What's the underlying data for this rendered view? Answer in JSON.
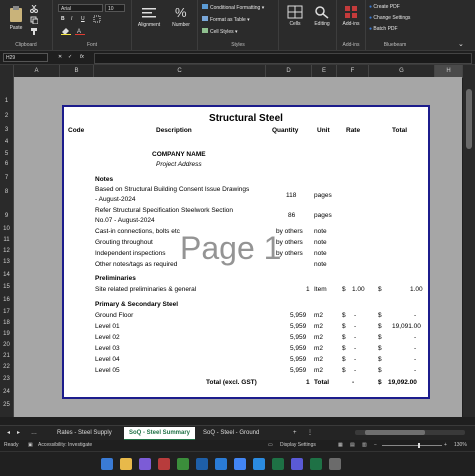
{
  "ribbon": {
    "clipboard": {
      "paste": "Paste",
      "label": "Clipboard"
    },
    "font": {
      "name": "Arial",
      "size": "10",
      "label": "Font",
      "bold": "B",
      "italic": "I",
      "underline": "U"
    },
    "alignment": "Alignment",
    "number": "Number",
    "styles": {
      "conditional": "Conditional Formatting",
      "table": "Format as Table",
      "cell_styles": "Cell Styles",
      "label": "Styles"
    },
    "cells": "Cells",
    "editing": "Editing",
    "addins": {
      "button": "Add-ins",
      "label": "Add-ins"
    },
    "bluebeam": {
      "create": "Create PDF",
      "change": "Change Settings",
      "batch": "Batch PDF",
      "label": "Bluebeam"
    }
  },
  "formula_bar": {
    "cell": "H29",
    "fx": "fx"
  },
  "columns": [
    "A",
    "B",
    "C",
    "D",
    "E",
    "F",
    "G",
    "H"
  ],
  "rows": [
    "1",
    "2",
    "3",
    "4",
    "5",
    "6",
    "7",
    "8",
    "9",
    "10",
    "11",
    "12",
    "13",
    "14",
    "15",
    "16",
    "17",
    "18",
    "19",
    "20",
    "21",
    "22",
    "23",
    "24",
    "25"
  ],
  "sheet": {
    "title": "Structural Steel",
    "headers": {
      "code": "Code",
      "description": "Description",
      "quantity": "Quantity",
      "unit": "Unit",
      "rate": "Rate",
      "total": "Total"
    },
    "company": "COMPANY NAME",
    "project": "Project Address",
    "notes_title": "Notes",
    "notes": [
      {
        "text": "Based on Structural Building Consent Issue Drawings",
        "text2": "- August-2024",
        "qty": "118",
        "unit": "pages"
      },
      {
        "text": "Refer Structural Specification Steelwork Section",
        "text2": "No.07 - August-2024",
        "qty": "86",
        "unit": "pages"
      },
      {
        "text": "Cast-in connections, bolts etc",
        "qty": "by others",
        "unit": "note"
      },
      {
        "text": "Grouting throughout",
        "qty": "by others",
        "unit": "note"
      },
      {
        "text": "Independent inspections",
        "qty": "by others",
        "unit": "note"
      },
      {
        "text": "Other notes/tags as required",
        "qty": "",
        "unit": "note"
      }
    ],
    "prelim_title": "Preliminaries",
    "prelim": {
      "text": "Site related preliminaries & general",
      "qty": "1",
      "unit": "Item",
      "cur": "$",
      "rate": "1.00",
      "cur2": "$",
      "total": "1.00"
    },
    "primary_title": "Primary & Secondary Steel",
    "levels": [
      {
        "name": "Ground Floor",
        "qty": "5,959",
        "unit": "m2",
        "cur": "$",
        "rate": "-",
        "cur2": "$",
        "total": "-"
      },
      {
        "name": "Level 01",
        "qty": "5,959",
        "unit": "m2",
        "cur": "$",
        "rate": "-",
        "cur2": "$",
        "total": "19,091.00"
      },
      {
        "name": "Level 02",
        "qty": "5,959",
        "unit": "m2",
        "cur": "$",
        "rate": "-",
        "cur2": "$",
        "total": "-"
      },
      {
        "name": "Level 03",
        "qty": "5,959",
        "unit": "m2",
        "cur": "$",
        "rate": "-",
        "cur2": "$",
        "total": "-"
      },
      {
        "name": "Level 04",
        "qty": "5,959",
        "unit": "m2",
        "cur": "$",
        "rate": "-",
        "cur2": "$",
        "total": "-"
      },
      {
        "name": "Level 05",
        "qty": "5,959",
        "unit": "m2",
        "cur": "$",
        "rate": "-",
        "cur2": "$",
        "total": "-"
      }
    ],
    "total_row": {
      "label": "Total (excl. GST)",
      "qty": "1",
      "unit": "Total",
      "rate": "-",
      "cur": "$",
      "total": "19,092.00"
    }
  },
  "watermark": "Page 1",
  "tabs": [
    "Rates - Steel Supply",
    "SoQ - Steel Summary",
    "SoQ - Steel - Ground"
  ],
  "status": {
    "ready": "Ready",
    "accessibility": "Accessibility: Investigate",
    "display": "Display Settings",
    "zoom": "130%"
  },
  "colors": {
    "accent": "#1e7145",
    "page_border": "#1c1c8c",
    "addins": "#c43b3b",
    "bluebeam": "#3a7bd5"
  }
}
